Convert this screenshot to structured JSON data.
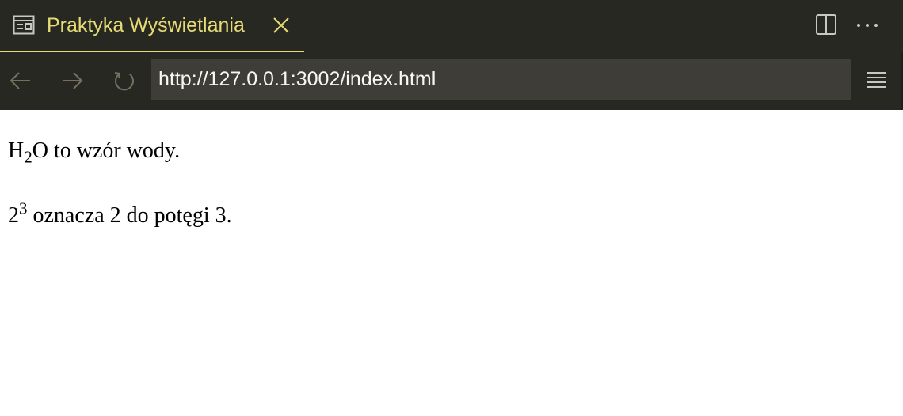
{
  "tab": {
    "title": "Praktyka Wyświetlania",
    "icon": "preview-icon",
    "accent_color": "#e6db74"
  },
  "toolbar": {
    "back_icon": "arrow-left-icon",
    "forward_icon": "arrow-right-icon",
    "reload_icon": "reload-icon",
    "menu_icon": "menu-icon",
    "split_icon": "split-editor-icon",
    "more_icon": "more-actions-icon",
    "close_icon": "close-icon"
  },
  "address_bar": {
    "url": "http://127.0.0.1:3002/index.html"
  },
  "page": {
    "paragraph1": {
      "base": "H",
      "subscript": "2",
      "rest": "O to wzór wody."
    },
    "paragraph2": {
      "base": "2",
      "superscript": "3",
      "rest": " oznacza 2 do potęgi 3."
    }
  },
  "colors": {
    "chrome_background": "#272822",
    "url_background": "#3e3d37",
    "url_text": "#f8f8f2",
    "icon_dim": "#75715e",
    "icon_light": "#c8c8c2"
  }
}
